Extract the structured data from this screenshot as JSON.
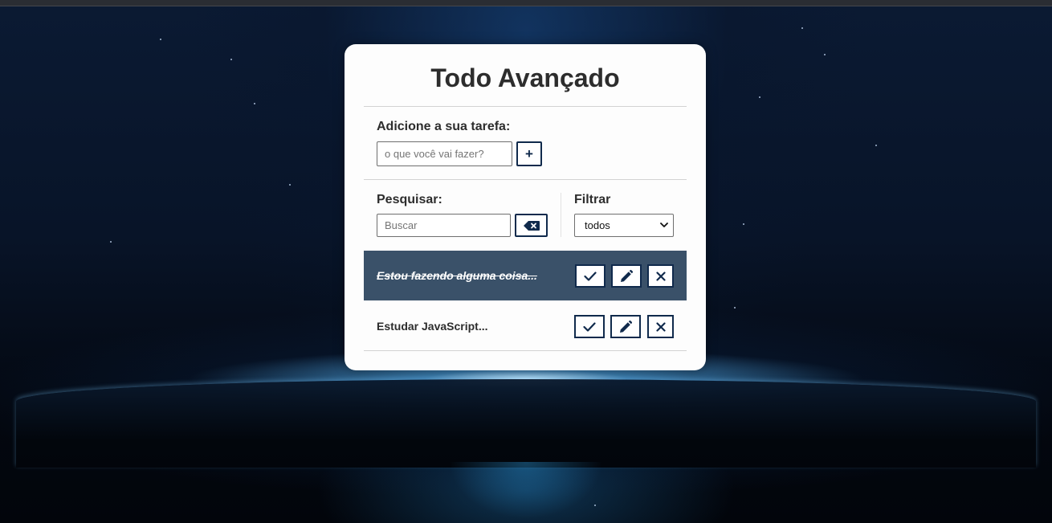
{
  "app": {
    "title": "Todo Avançado"
  },
  "add_section": {
    "label": "Adicione a sua tarefa:",
    "input_placeholder": "o que você vai fazer?",
    "input_value": "",
    "add_button_label": "+"
  },
  "search_section": {
    "label": "Pesquisar:",
    "input_placeholder": "Buscar",
    "input_value": "",
    "clear_button_icon": "backspace-icon"
  },
  "filter_section": {
    "label": "Filtrar",
    "selected": "todos"
  },
  "todos": [
    {
      "text": "Estou fazendo alguma coisa...",
      "done": true
    },
    {
      "text": "Estudar JavaScript...",
      "done": false
    }
  ],
  "row_actions": {
    "finish_icon": "check-icon",
    "edit_icon": "pencil-icon",
    "remove_icon": "close-icon"
  },
  "colors": {
    "accent": "#102a4c",
    "done_row_background": "#3a5169",
    "card_background": "#fdfdfd"
  }
}
